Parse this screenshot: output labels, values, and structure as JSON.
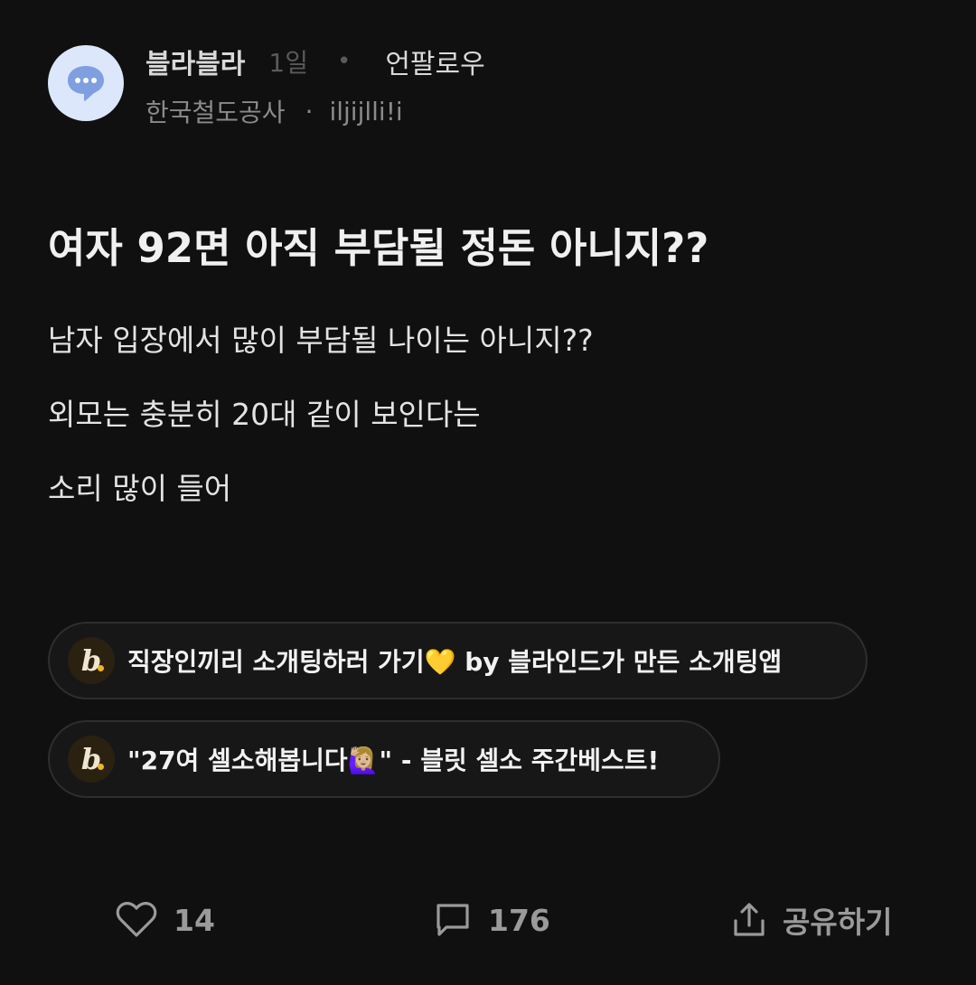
{
  "header": {
    "avatar_icon": "chat-bubble-icon",
    "community": "블라블라",
    "time": "1일",
    "dot": "•",
    "unfollow_label": "언팔로우",
    "company": "한국철도공사",
    "separator": "·",
    "nickname": "iljijlli!i"
  },
  "post": {
    "title": "여자 92면 아직 부담될 정돈 아니지??",
    "lines": [
      "남자 입장에서 많이 부담될 나이는 아니지??",
      "외모는 충분히 20대 같이 보인다는",
      "소리 많이 들어"
    ]
  },
  "promos": [
    {
      "logo": "b",
      "text": "직장인끼리 소개팅하러 가기💛 by 블라인드가 만든 소개팅앱"
    },
    {
      "logo": "b",
      "text": "\"27여 셀소해봅니다🙋🏼‍♀️\" - 블릿 셀소 주간베스트!"
    }
  ],
  "actions": {
    "like_count": "14",
    "comment_count": "176",
    "share_label": "공유하기",
    "icons": [
      "heart-icon",
      "comment-icon",
      "share-icon"
    ]
  },
  "colors": {
    "background": "#101010",
    "avatar_bg": "#dce7fb",
    "avatar_icon": "#7f9fe0",
    "muted": "#5a5a5a"
  }
}
